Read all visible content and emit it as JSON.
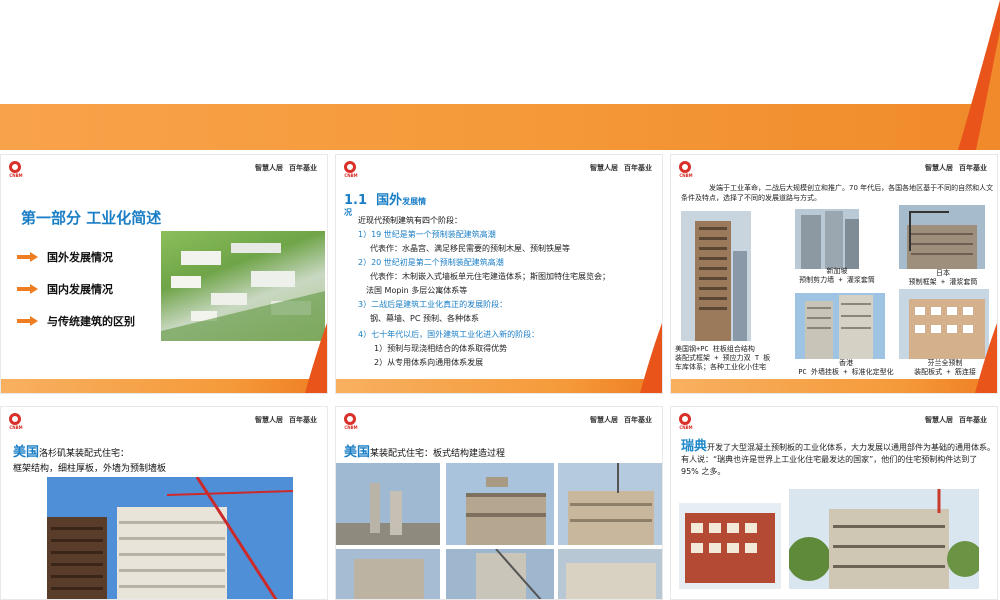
{
  "slide1": {
    "brand1": "智慧人居",
    "brand2": "百年基业",
    "logo_text": "CNBM",
    "title": "第一部分    工业化简述",
    "items": [
      {
        "label": "国外发展情况"
      },
      {
        "label": "国内发展情况"
      },
      {
        "label": "与传统建筑的区别"
      }
    ]
  },
  "slide2": {
    "brand1": "智慧人居",
    "brand2": "百年基业",
    "heading_num": "1.1",
    "heading_main": "国外",
    "heading_small": "发展情",
    "heading_tail": "况",
    "intro": "近现代预制建筑有四个阶段：",
    "lines": [
      {
        "text": "1）19 世纪是第一个预制装配建筑高潮",
        "style": "b"
      },
      {
        "text": "代表作：水晶宫、满足移民需要的预制木屋、预制铁屋等",
        "style": ""
      },
      {
        "text": "2）20 世纪初是第二个预制装配建筑高潮",
        "style": "b"
      },
      {
        "text": "代表作：木制嵌入式墙板单元住宅建造体系；斯图加特住宅展览会；",
        "style": ""
      },
      {
        "text": "法国 Mopin 多层公寓体系等",
        "style": ""
      },
      {
        "text": "3）二战后是建筑工业化真正的发展阶段：",
        "style": "b"
      },
      {
        "text": "钢、幕墙、PC 预制、各种体系",
        "style": ""
      },
      {
        "text": "4）七十年代以后，国外建筑工业化进入新的阶段：",
        "style": "b"
      },
      {
        "text": "1）预制与现浇相结合的体系取得优势",
        "style": ""
      },
      {
        "text": "2）从专用体系向通用体系发展",
        "style": ""
      }
    ]
  },
  "slide3": {
    "brand1": "智慧人居",
    "brand2": "百年基业",
    "text": "发端于工业革命，二战后大规模创立和推广。70 年代后，各国各地区基于不同的自然和人文条件及特点，选择了不同的发展道路与方式。",
    "captions": {
      "usa": "美国钢+PC 柱板组合结构\n装配式框架 + 预应力双 T 板\n车库体系；各种工业化小住宅",
      "singapore": "新加坡\n预制剪力墙 + 灌浆套筒",
      "japan": "日本\n预制框架 + 灌浆套筒",
      "hongkong": "香港\nPC 外墙挂板 + 标准化定型化",
      "finland": "芬兰全预制\n装配板式 + 筋连接"
    }
  },
  "slide4": {
    "brand1": "智慧人居",
    "brand2": "百年基业",
    "title_main": "美国",
    "title_rest": "洛杉矶某装配式住宅：",
    "sub": "框架结构，细柱厚板，外墙为预制墙板"
  },
  "slide5": {
    "brand1": "智慧人居",
    "brand2": "百年基业",
    "title_main": "美国",
    "title_rest": "某装配式住宅：板式结构建造过程"
  },
  "slide6": {
    "brand1": "智慧人居",
    "brand2": "百年基业",
    "title_main": "瑞典",
    "text": "开发了大型混凝土预制板的工业化体系，大力发展以通用部件为基础的通用体系。有人说：“瑞典也许是世界上工业化住宅最发达的国家”，他们的住宅预制构件达到了 95% 之多。"
  },
  "colors": {
    "accent_orange": "#ee7d22",
    "accent_blue": "#1a7ec6",
    "logo_red": "#d9302a"
  }
}
